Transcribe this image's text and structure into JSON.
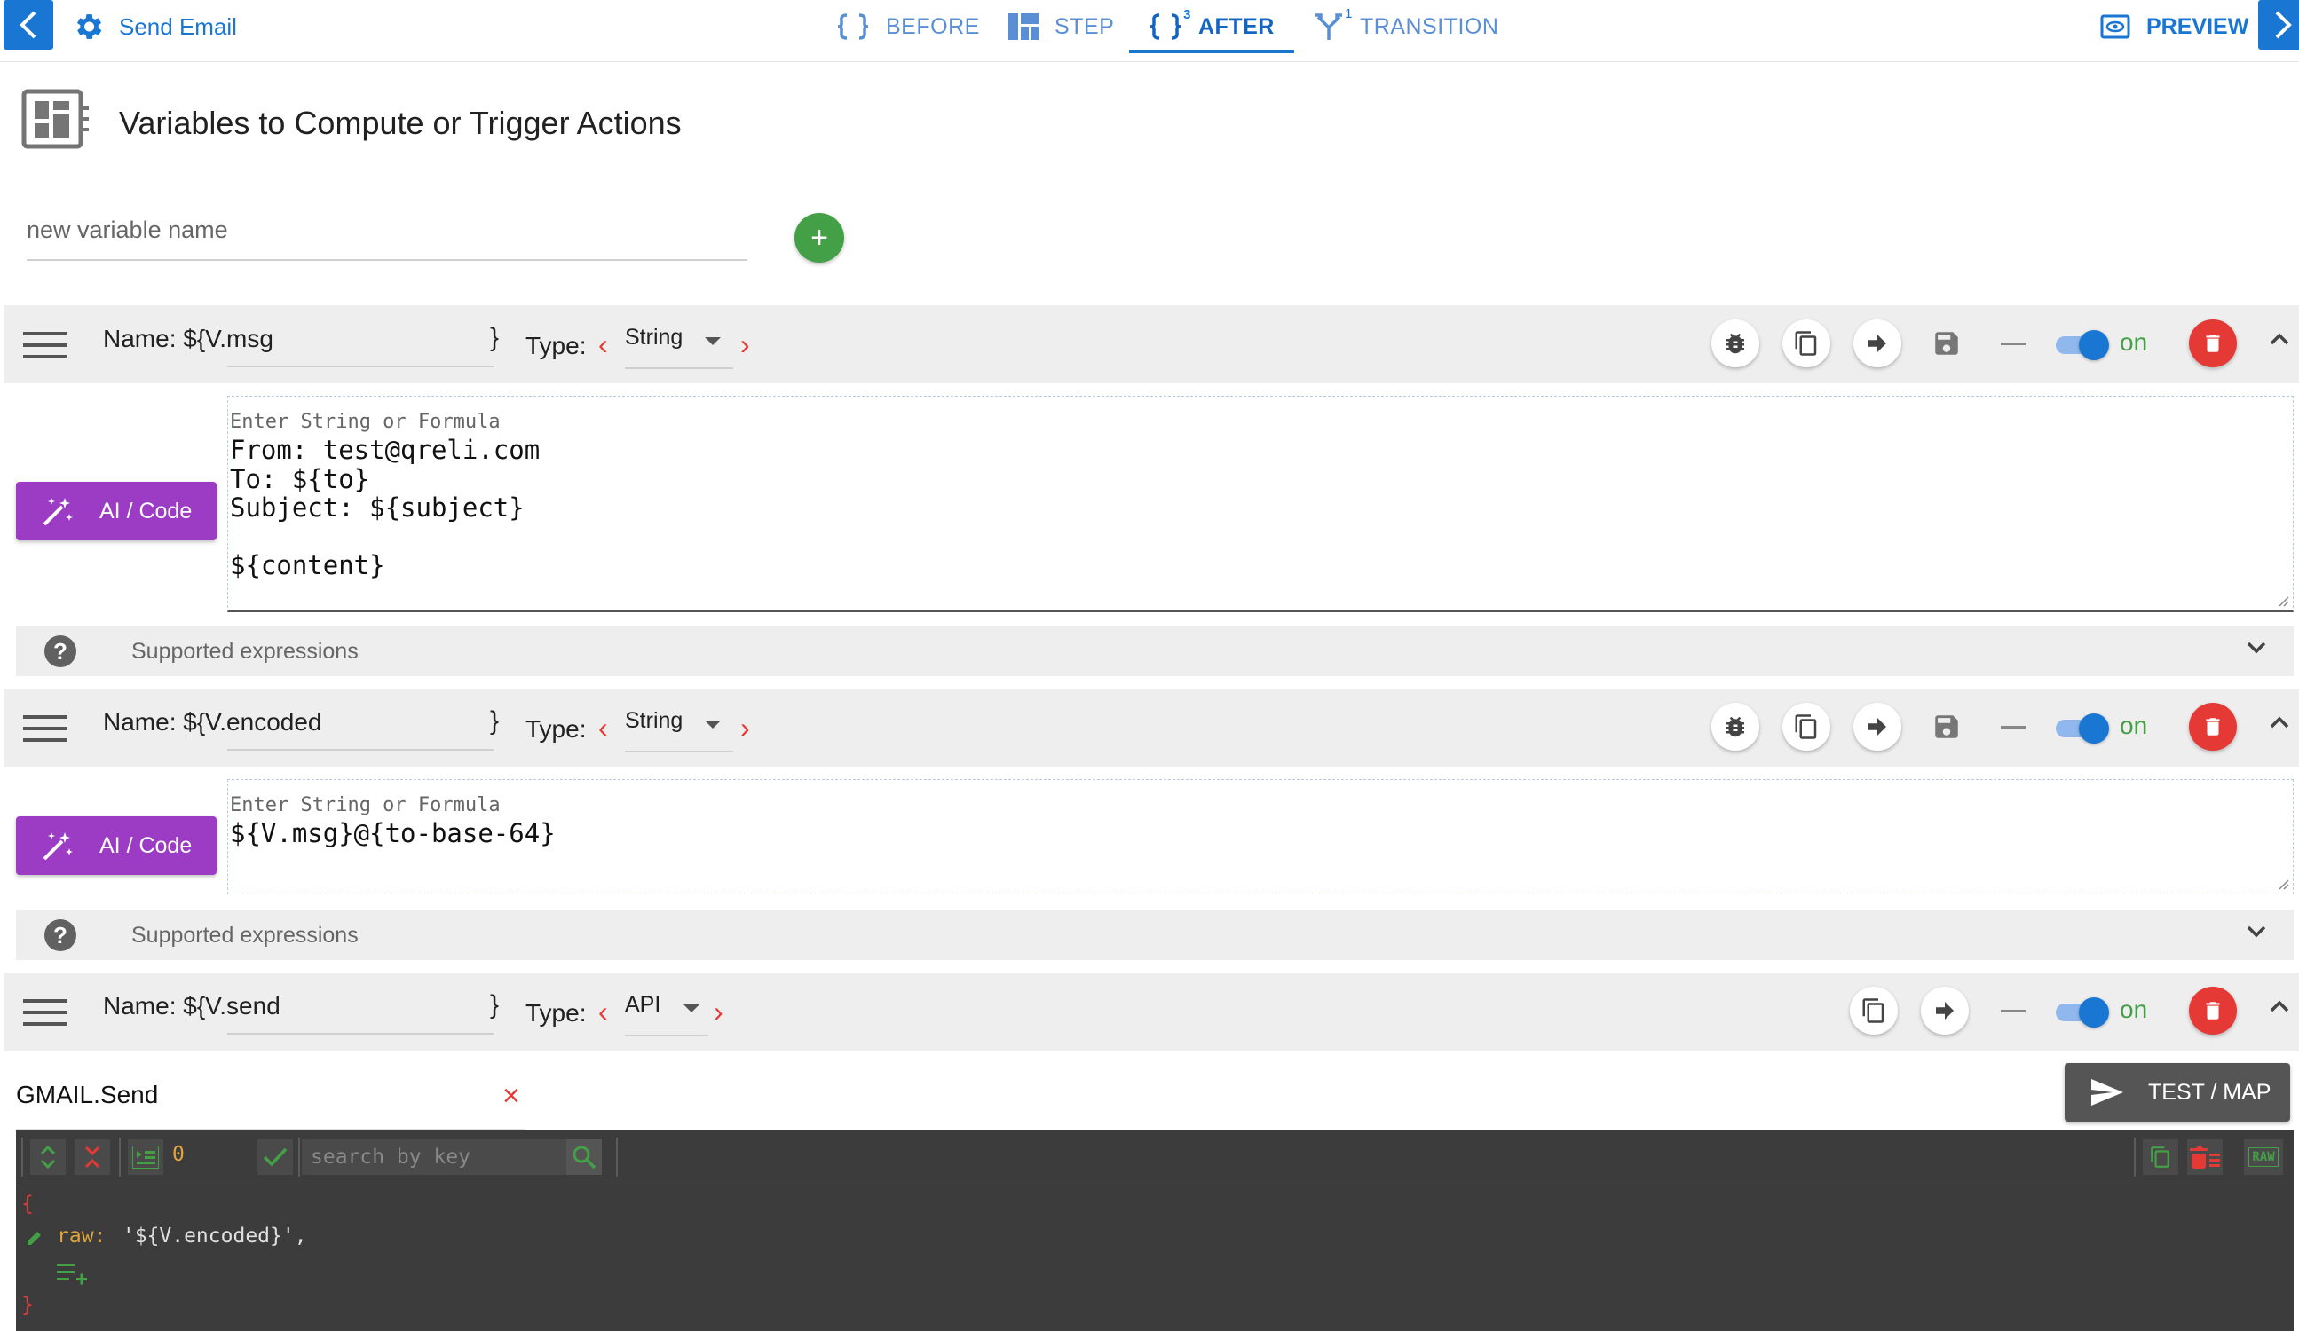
{
  "header": {
    "title": "Send Email",
    "tabs": [
      {
        "label": "BEFORE",
        "badge": ""
      },
      {
        "label": "STEP",
        "badge": ""
      },
      {
        "label": "AFTER",
        "badge": "3"
      },
      {
        "label": "TRANSITION",
        "badge": "1"
      }
    ],
    "preview": "PREVIEW"
  },
  "section": {
    "title": "Variables to Compute or Trigger Actions",
    "new_var_placeholder": "new variable name",
    "add": "+"
  },
  "variables": [
    {
      "name_label": "Name: ${V.msg",
      "close": "}",
      "type_label": "Type:",
      "type": "String",
      "toggle": "on",
      "ai_label": "AI / Code",
      "placeholder": "Enter String or Formula",
      "code": "From: test@qreli.com\nTo: ${to}\nSubject: ${subject}\n\n${content}",
      "supported": "Supported expressions"
    },
    {
      "name_label": "Name: ${V.encoded",
      "close": "}",
      "type_label": "Type:",
      "type": "String",
      "toggle": "on",
      "ai_label": "AI / Code",
      "placeholder": "Enter String or Formula",
      "code": "${V.msg}@{to-base-64}",
      "supported": "Supported expressions"
    },
    {
      "name_label": "Name: ${V.send",
      "close": "}",
      "type_label": "Type:",
      "type": "API",
      "toggle": "on",
      "api_name": "GMAIL.Send",
      "test_label": "TEST / MAP"
    }
  ],
  "json_editor": {
    "count": "0",
    "search_placeholder": "search by key",
    "raw": "RAW",
    "open_brace": "{",
    "key": "raw:",
    "value": " '${V.encoded}',",
    "close_brace": "}"
  },
  "colors": {
    "primary": "#1976d2",
    "success": "#43a047",
    "danger": "#e53935",
    "ai_purple": "#9c3cc4",
    "editor_bg": "#3c3c3c"
  }
}
